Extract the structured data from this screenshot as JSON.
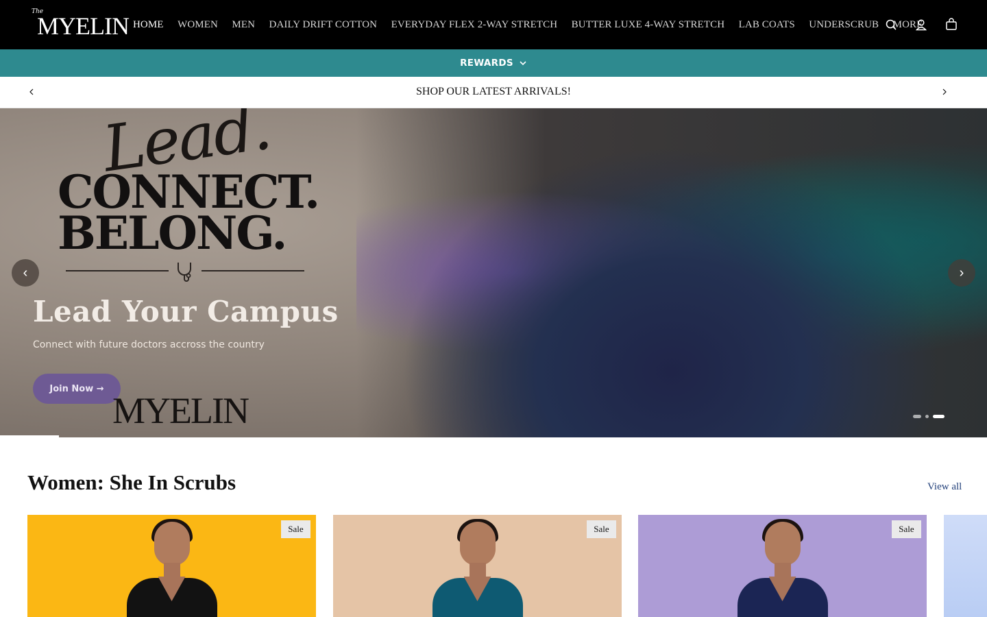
{
  "header": {
    "logo_text": "MYELIN",
    "logo_script": "The",
    "nav": [
      "HOME",
      "WOMEN",
      "MEN",
      "DAILY DRIFT COTTON",
      "EVERYDAY FLEX 2-WAY STRETCH",
      "BUTTER LUXE 4-WAY STRETCH",
      "LAB COATS",
      "UNDERSCRUB",
      "MORE"
    ],
    "active_nav": "HOME",
    "icons": [
      "search-icon",
      "account-icon",
      "cart-icon"
    ]
  },
  "rewards": {
    "label": "REWARDS"
  },
  "announcement": {
    "text": "SHOP OUR LATEST ARRIVALS!"
  },
  "hero": {
    "script_text": "Lead.",
    "headline_line1": "CONNECT.",
    "headline_line2": "BELONG.",
    "title": "Lead Your Campus",
    "subtitle": "Connect with future doctors accross the country",
    "cta_label": "Join Now →",
    "brand_text": "MYELIN",
    "prev_label": "‹",
    "next_label": "›",
    "slide_count": 3,
    "active_slide": 3
  },
  "section": {
    "title": "Women: She In Scrubs",
    "view_all": "View all",
    "products": [
      {
        "badge": "Sale",
        "bg": "#fbb714",
        "scrub_color": "#121212"
      },
      {
        "badge": "Sale",
        "bg": "#e5c4a6",
        "scrub_color": "#0e5a72"
      },
      {
        "badge": "Sale",
        "bg": "#ad9cd6",
        "scrub_color": "#1b2554"
      }
    ]
  },
  "colors": {
    "header_bg": "#000000",
    "rewards_bg": "#2e8a8f",
    "cta_bg": "#6e5a94",
    "link": "#22407a"
  }
}
